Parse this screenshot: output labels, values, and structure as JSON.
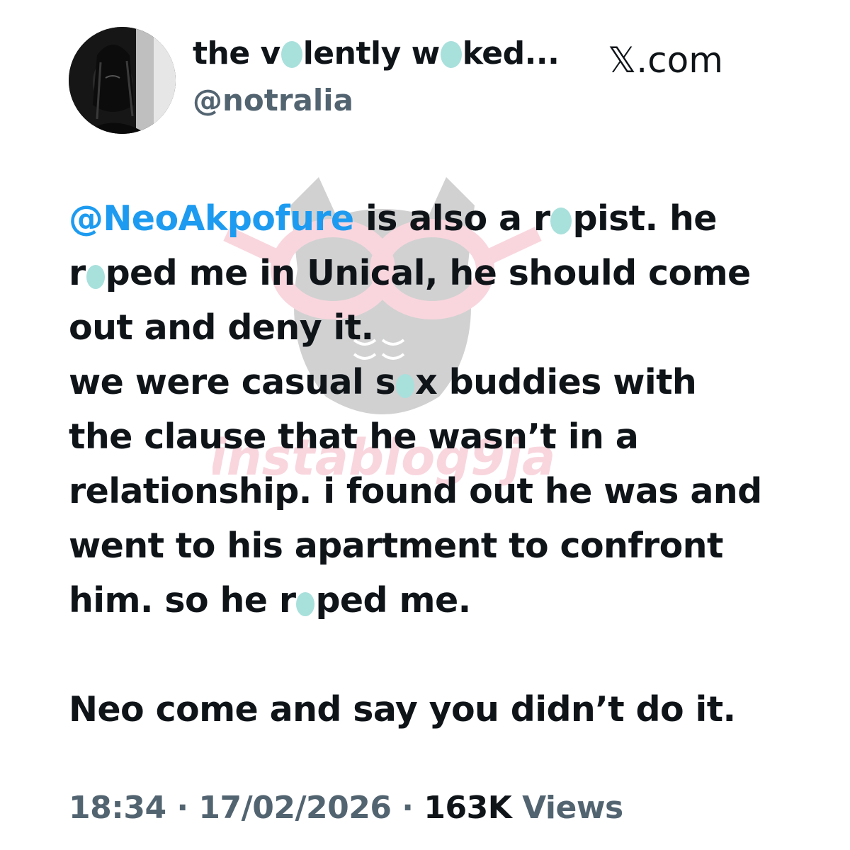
{
  "tweet": {
    "author": {
      "display_name_parts": [
        "the v",
        "lently w",
        "ked..."
      ],
      "handle": "@notralia"
    },
    "source": "𝕏.com",
    "body": {
      "mention": "@NeoAkpofure",
      "line1_rest": " is also a r",
      "line1_end": "pist. he",
      "line2_start": "r",
      "line2_end": "ped me in Unical, he should come",
      "line3": "out and deny it.",
      "line4_start": "we were casual s",
      "line4_end": "x buddies with",
      "line5": "the clause that he wasn’t in a",
      "line6": "relationship. i found out he was and",
      "line7": "went to his apartment to confront",
      "line8_start": "him. so he r",
      "line8_end": "ped me.",
      "line10": "Neo come and say you didn’t do it."
    },
    "meta": {
      "time": "18:34",
      "separator": " · ",
      "date": "17/02/2026",
      "views_count": "163K",
      "views_label": " Views"
    },
    "watermark": "instablog9ja",
    "colors": {
      "text": "#0f1419",
      "secondary": "#536471",
      "mention": "#1d9bf0",
      "censor_blot": "#a8e0dc",
      "watermark_pink": "#f2a6b8",
      "watermark_gray": "#9a9a9a"
    }
  }
}
